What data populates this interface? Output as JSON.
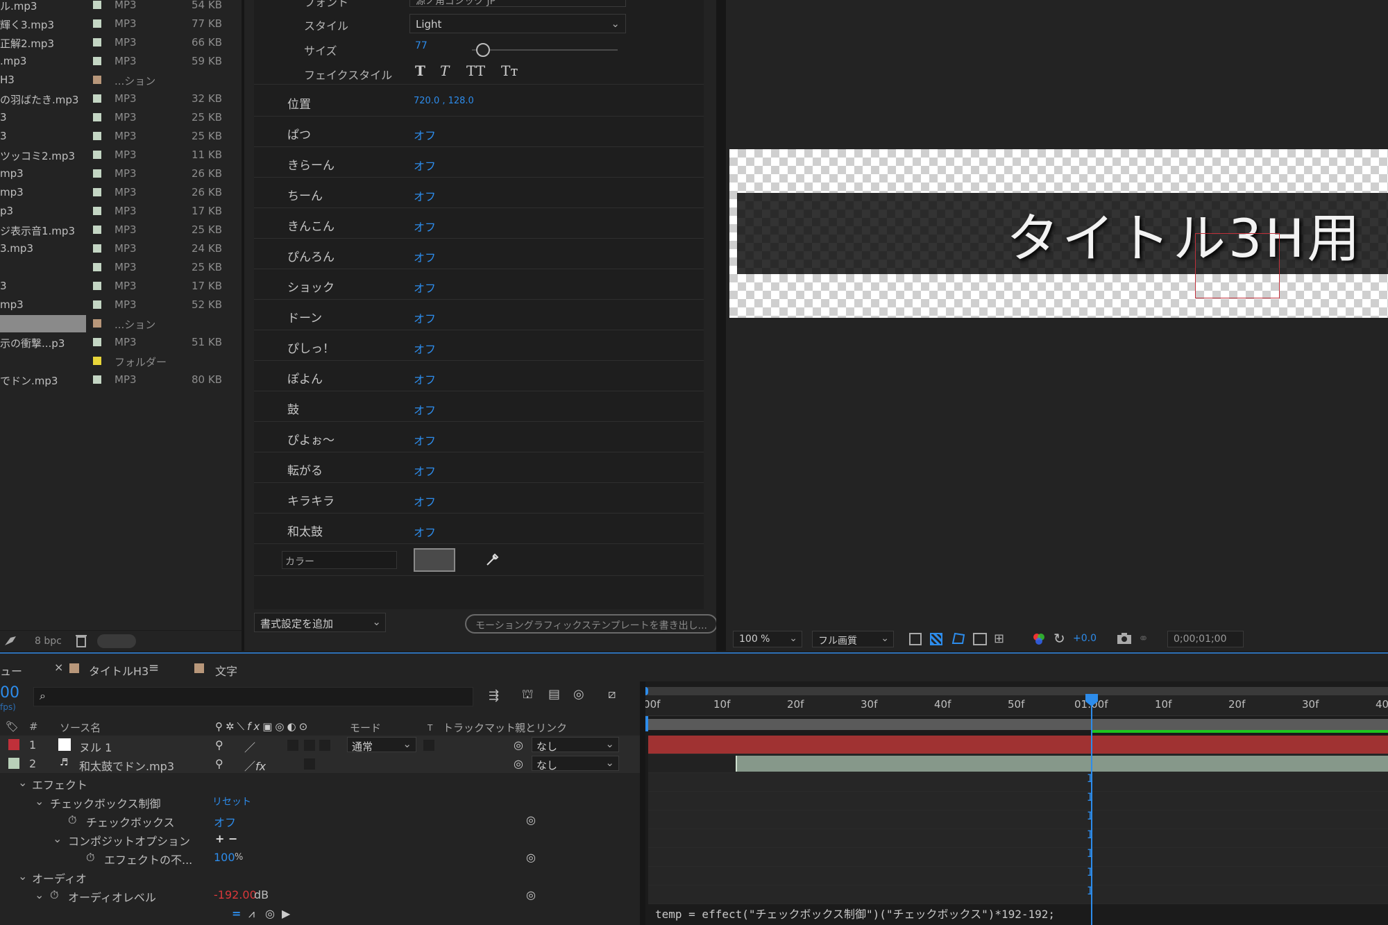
{
  "project": {
    "rows": [
      {
        "name": "ル.mp3",
        "label_color": "#c4d6c4",
        "type": "MP3",
        "size": "54 KB"
      },
      {
        "name": "輝く3.mp3",
        "label_color": "#c4d6c4",
        "type": "MP3",
        "size": "77 KB"
      },
      {
        "name": "正解2.mp3",
        "label_color": "#c4d6c4",
        "type": "MP3",
        "size": "66 KB"
      },
      {
        "name": ".mp3",
        "label_color": "#c4d6c4",
        "type": "MP3",
        "size": "59 KB"
      },
      {
        "name": "H3",
        "label_color": "#b8977a",
        "type": "...ション",
        "size": ""
      },
      {
        "name": "の羽ばたき.mp3",
        "label_color": "#c4d6c4",
        "type": "MP3",
        "size": "32 KB"
      },
      {
        "name": "3",
        "label_color": "#c4d6c4",
        "type": "MP3",
        "size": "25 KB"
      },
      {
        "name": "3",
        "label_color": "#c4d6c4",
        "type": "MP3",
        "size": "25 KB"
      },
      {
        "name": "ツッコミ2.mp3",
        "label_color": "#c4d6c4",
        "type": "MP3",
        "size": "11 KB"
      },
      {
        "name": "mp3",
        "label_color": "#c4d6c4",
        "type": "MP3",
        "size": "26 KB"
      },
      {
        "name": "mp3",
        "label_color": "#c4d6c4",
        "type": "MP3",
        "size": "26 KB"
      },
      {
        "name": "p3",
        "label_color": "#c4d6c4",
        "type": "MP3",
        "size": "17 KB"
      },
      {
        "name": "ジ表示音1.mp3",
        "label_color": "#c4d6c4",
        "type": "MP3",
        "size": "25 KB"
      },
      {
        "name": "3.mp3",
        "label_color": "#c4d6c4",
        "type": "MP3",
        "size": "24 KB"
      },
      {
        "name": "",
        "label_color": "#c4d6c4",
        "type": "MP3",
        "size": "25 KB"
      },
      {
        "name": "3",
        "label_color": "#c4d6c4",
        "type": "MP3",
        "size": "17 KB"
      },
      {
        "name": "mp3",
        "label_color": "#c4d6c4",
        "type": "MP3",
        "size": "52 KB"
      },
      {
        "name": "",
        "label_color": "#b8977a",
        "type": "...ション",
        "size": "",
        "selected": true
      },
      {
        "name": "示の衝撃...p3",
        "label_color": "#c4d6c4",
        "type": "MP3",
        "size": "51 KB"
      },
      {
        "name": "",
        "label_color": "#e8d63a",
        "type": "フォルダー",
        "size": ""
      },
      {
        "name": "でドン.mp3",
        "label_color": "#c4d6c4",
        "type": "MP3",
        "size": "80 KB"
      }
    ],
    "footer": {
      "bpc": "8 bpc"
    }
  },
  "eg": {
    "font_label": "フォント",
    "font_value": "源ノ角ゴシック JP",
    "style_label": "スタイル",
    "style_value": "Light",
    "size_label": "サイズ",
    "size_value": "77",
    "faux_label": "フェイクスタイル",
    "faux_buttons": [
      "T",
      "T",
      "TT",
      "Tт"
    ],
    "position_label": "位置",
    "position_value": "720.0 , 128.0",
    "toggles": [
      {
        "label": "ぱつ",
        "value": "オフ"
      },
      {
        "label": "きらーん",
        "value": "オフ"
      },
      {
        "label": "ちーん",
        "value": "オフ"
      },
      {
        "label": "きんこん",
        "value": "オフ"
      },
      {
        "label": "ぴんろん",
        "value": "オフ"
      },
      {
        "label": "ショック",
        "value": "オフ"
      },
      {
        "label": "ドーン",
        "value": "オフ"
      },
      {
        "label": "ぴしっ！",
        "value": "オフ"
      },
      {
        "label": "ぽよん",
        "value": "オフ"
      },
      {
        "label": "鼓",
        "value": "オフ"
      },
      {
        "label": "ぴよぉ〜",
        "value": "オフ"
      },
      {
        "label": "転がる",
        "value": "オフ"
      },
      {
        "label": "キラキラ",
        "value": "オフ"
      },
      {
        "label": "和太鼓",
        "value": "オフ"
      }
    ],
    "color_label": "カラー",
    "color_swatch": "#4a4a4a",
    "add_format": "書式設定を追加",
    "export_button": "モーショングラフィックステンプレートを書き出し..."
  },
  "viewer": {
    "title_text": "タイトル3H用",
    "zoom": "100 %",
    "quality": "フル画質",
    "exposure": "+0.0",
    "timecode": "0;00;01;00"
  },
  "timeline": {
    "tabs": [
      {
        "label": "ュー"
      },
      {
        "label": "タイトルH3",
        "color": "#b8977a",
        "active": true
      },
      {
        "label": "文字",
        "color": "#b8977a"
      }
    ],
    "current_time": "00",
    "fps": "fps)",
    "columns": {
      "num": "#",
      "source": "ソース名",
      "mode": "モード",
      "t": "T",
      "trackmatte": "トラックマット",
      "parent": "親とリンク"
    },
    "layers": [
      {
        "index": "1",
        "name": "ヌル 1",
        "label_color": "#c0303a",
        "mode": "通常",
        "parent": "なし"
      },
      {
        "index": "2",
        "name": "和太鼓でドン.mp3",
        "label_color": "#b9d0b9",
        "parent": "なし"
      }
    ],
    "props": {
      "effects": "エフェクト",
      "checkbox_control": "チェックボックス制御",
      "reset": "リセット",
      "checkbox": "チェックボックス",
      "checkbox_value": "オフ",
      "composite": "コンポジットオプション",
      "composite_ctrl": "+ −",
      "effect_opacity": "エフェクトの不...",
      "effect_opacity_value": "100",
      "effect_opacity_unit": "%",
      "audio": "オーディオ",
      "audio_level": "オーディオレベル",
      "audio_level_value": "-192.00",
      "audio_level_unit": "dB"
    },
    "ruler": [
      ":00f",
      "10f",
      "20f",
      "30f",
      "40f",
      "50f",
      "01:00f",
      "10f",
      "20f",
      "30f",
      "40"
    ],
    "expression": "temp = effect(\"チェックボックス制御\")(\"チェックボックス\")*192-192;"
  }
}
